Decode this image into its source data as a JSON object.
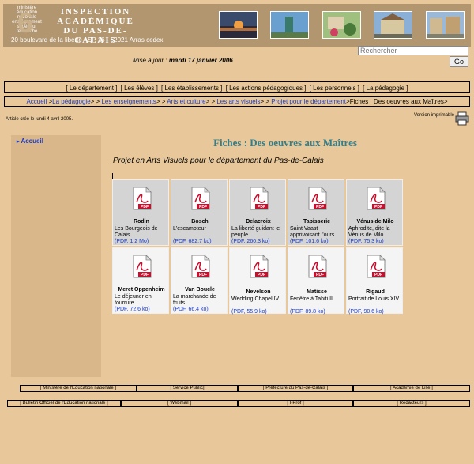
{
  "header": {
    "logo_lines": [
      "ministère",
      "éducation",
      "nationale",
      "enseignement",
      "supérieur",
      "recherche"
    ],
    "title": "Inspection académique du Pas-de-Calais",
    "title_lines": [
      "INSPECTION",
      "ACADÉMIQUE",
      "DU PAS-DE-CALAIS"
    ],
    "address": "20 boulevard de la liberté - SP 16 - 62021 Arras cedex"
  },
  "update": {
    "label": "Mise à jour :",
    "date": "mardi 17 janvier 2006"
  },
  "search": {
    "placeholder": "Rechercher",
    "button": "Go"
  },
  "nav": [
    "[ Le département ]",
    "[ Les élèves ]",
    "[ Les établissements ]",
    "[ Les actions pédagogiques ]",
    "[ Les personnels ]",
    "[ La pédagogie ]"
  ],
  "breadcrumb": {
    "items": [
      "Accueil",
      "La pédagogie",
      "Les enseignements",
      "Arts et culture",
      "Les arts visuels",
      "Projet pour le département"
    ],
    "current": "Fiches : Des oeuvres aux Maîtres"
  },
  "article": {
    "created": "Article créé le lundi 4 avril 2005.",
    "printable": "Version imprimable",
    "title": "Fiches : Des oeuvres aux Maîtres",
    "subtitle": "Projet en Arts Visuels pour le département du Pas-de-Calais"
  },
  "sidebar": {
    "items": [
      "Accueil"
    ]
  },
  "documents": [
    {
      "name": "Rodin",
      "desc": "Les Bourgeois de Calais",
      "size": "(PDF, 1.2 Mo)"
    },
    {
      "name": "Bosch",
      "desc": "L'escamoteur",
      "size": "(PDF, 682.7 ko)"
    },
    {
      "name": "Delacroix",
      "desc": "La liberté guidant le peuple",
      "size": "(PDF, 260.3 ko)"
    },
    {
      "name": "Tapisserie",
      "desc": "Saint Vaast apprivoisant l'ours",
      "size": "(PDF, 101.6 ko)"
    },
    {
      "name": "Vénus de Milo",
      "desc": "Aphrodite, dite la Vénus de Milo",
      "size": "(PDF, 75.3 ko)"
    },
    {
      "name": "Meret Oppenheim",
      "desc": "Le déjeuner en fourrure",
      "size": "(PDF, 72.6 ko)"
    },
    {
      "name": "Van Boucle",
      "desc": "La marchande de fruits",
      "size": "(PDF, 66.4 ko)"
    },
    {
      "name": "Nevelson",
      "desc": "Wedding Chapel IV",
      "size": "(PDF, 55.9 ko)"
    },
    {
      "name": "Matisse",
      "desc": "Fenêtre à Tahiti II",
      "size": "(PDF, 89.8 ko)"
    },
    {
      "name": "Rigaud",
      "desc": "Portrait de Louis XIV",
      "size": "(PDF, 90.6 ko)"
    }
  ],
  "footer": {
    "row1": [
      "[ Ministère de l'Education nationale ]",
      "[ Service Public]",
      "[ Préfecture du Pas-de-Calais ]",
      "[ Académie de Lille ]"
    ],
    "row2": [
      "[ Bulletin Officiel de l'Education nationale ]",
      "[ Webmail ]",
      "[ I-Prof ]",
      "[ Rédacteurs ]"
    ]
  },
  "colors": {
    "link": "#1a3cc8",
    "title": "#2f7f8e",
    "background": "#e8c89a",
    "header": "#b29670"
  }
}
